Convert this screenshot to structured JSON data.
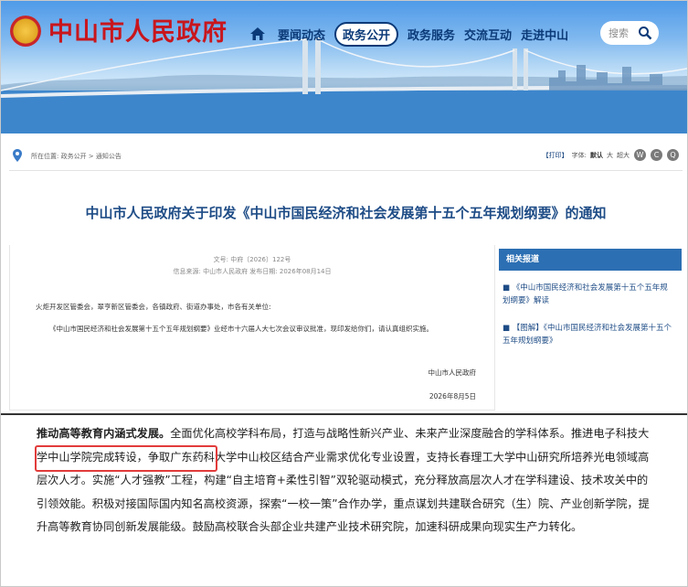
{
  "header": {
    "site_title": "中山市人民政府",
    "nav": [
      {
        "label": "要闻动态",
        "active": false
      },
      {
        "label": "政务公开",
        "active": true
      },
      {
        "label": "政务服务",
        "active": false
      },
      {
        "label": "交流互动",
        "active": false
      },
      {
        "label": "走进中山",
        "active": false
      }
    ],
    "search_placeholder": "搜索"
  },
  "breadcrumb": {
    "text": "所在位置:  政务公开 > 通知公告"
  },
  "tools": {
    "print": "【打印】",
    "font_label": "字体:",
    "font_default": "默认",
    "font_large": "大",
    "font_xlarge": "超大"
  },
  "doc": {
    "title": "中山市人民政府关于印发《中山市国民经济和社会发展第十五个五年规划纲要》的通知",
    "number": "文号: 中府〔2026〕122号",
    "meta": "信息来源: 中山市人民政府    发布日期: 2026年08月14日",
    "addressees": "火炬开发区管委会，翠亨新区管委会，各镇政府、街道办事处，市各有关单位:",
    "body": "《中山市国民经济和社会发展第十五个五年规划纲要》业经市十六届人大七次会议审议批准，现印发给你们，请认真组织实施。",
    "signature": "中山市人民政府",
    "date": "2026年8月5日"
  },
  "related": {
    "heading": "相关报道",
    "items": [
      "《中山市国民经济和社会发展第十五个五年规划纲要》解读",
      "【图解】《中山市国民经济和社会发展第十五个五年规划纲要》"
    ]
  },
  "article": {
    "lead": "推动高等教育内涵式发展。",
    "text1": "全面优化高校学科布局，打造与战略性新兴产业、未来产业深度融合的学科体系。推进",
    "highlight": "电子科技大学中山学院完成转设，",
    "text2": "争取广东药科大学中山校区结合产业需求优化专业设置，支持长春理工大学中山研究所培养光电领域高层次人才。实施“人才强教”工程，构建“自主培育+柔性引智”双轮驱动模式，充分释放高层次人才在学科建设、技术攻关中的引领效能。积极对接国际国内知名高校资源，探索“一校一策”合作办学，重点谋划共建联合研究（生）院、产业创新学院，提升高等教育协同创新发展能级。鼓励高校联合头部企业共建产业技术研究院，加速科研成果向现实生产力转化。"
  },
  "colors": {
    "title_red": "#c8161d",
    "nav_blue": "#0b3a78",
    "doc_title_blue": "#1e4c86",
    "related_head_bg": "#2c6fb3",
    "highlight_red": "#e23b3b"
  }
}
